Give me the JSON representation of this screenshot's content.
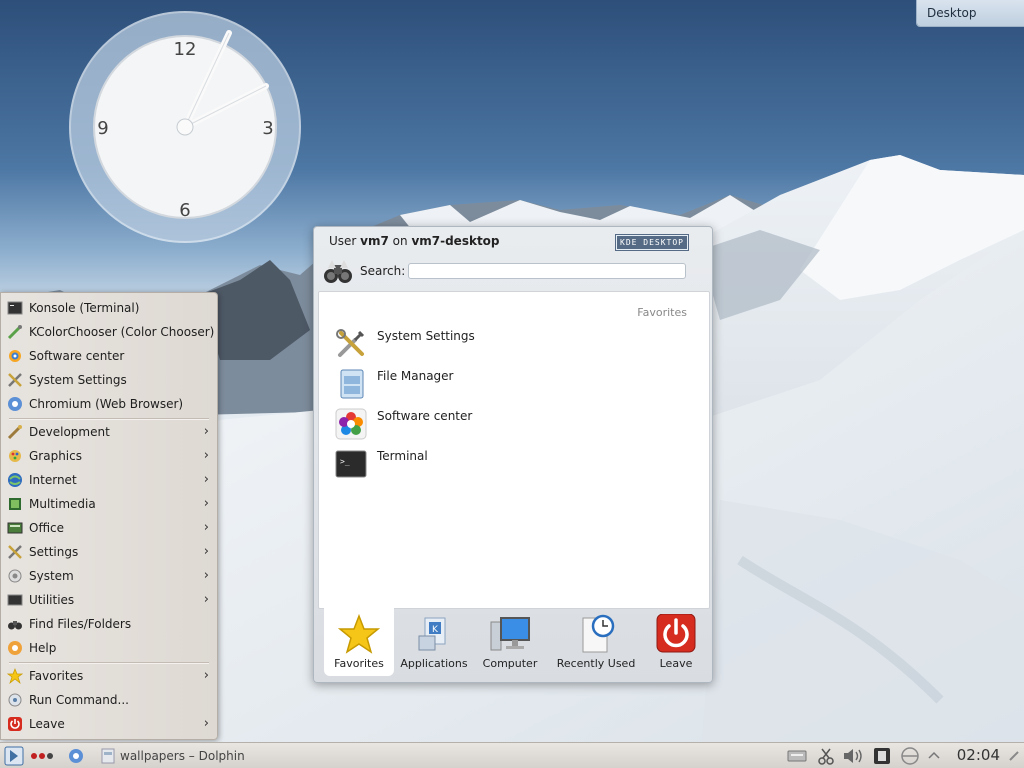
{
  "desktop_label": "Desktop",
  "clock": {
    "numerals": [
      "12",
      "3",
      "6",
      "9"
    ]
  },
  "kickoff": {
    "user_prefix": "User ",
    "user": "vm7",
    "on": " on ",
    "host": "vm7-desktop",
    "badge": "KDE DESKTOP",
    "search_label": "Search:",
    "search_value": "",
    "favorites_heading": "Favorites",
    "favorites": [
      {
        "label": "System Settings",
        "icon": "system-settings-icon"
      },
      {
        "label": "File Manager",
        "icon": "file-manager-icon"
      },
      {
        "label": "Software center",
        "icon": "software-center-icon"
      },
      {
        "label": "Terminal",
        "icon": "terminal-icon"
      }
    ],
    "tabs": [
      "Favorites",
      "Applications",
      "Computer",
      "Recently Used",
      "Leave"
    ]
  },
  "app_menu": [
    {
      "label": "Konsole (Terminal)",
      "icon": "konsole-icon",
      "submenu": false
    },
    {
      "label": "KColorChooser (Color Chooser)",
      "icon": "color-chooser-icon",
      "submenu": false
    },
    {
      "label": "Software center",
      "icon": "software-center-icon",
      "submenu": false
    },
    {
      "label": "System Settings",
      "icon": "system-settings-icon",
      "submenu": false
    },
    {
      "label": "Chromium (Web Browser)",
      "icon": "chromium-icon",
      "submenu": false
    },
    {
      "label": "Development",
      "icon": "development-icon",
      "submenu": true
    },
    {
      "label": "Graphics",
      "icon": "graphics-icon",
      "submenu": true
    },
    {
      "label": "Internet",
      "icon": "internet-icon",
      "submenu": true
    },
    {
      "label": "Multimedia",
      "icon": "multimedia-icon",
      "submenu": true
    },
    {
      "label": "Office",
      "icon": "office-icon",
      "submenu": true
    },
    {
      "label": "Settings",
      "icon": "settings-icon",
      "submenu": true
    },
    {
      "label": "System",
      "icon": "system-icon",
      "submenu": true
    },
    {
      "label": "Utilities",
      "icon": "utilities-icon",
      "submenu": true
    },
    {
      "label": "Find Files/Folders",
      "icon": "find-files-icon",
      "submenu": false
    },
    {
      "label": "Help",
      "icon": "help-icon",
      "submenu": false
    },
    {
      "label": "Favorites",
      "icon": "favorites-icon",
      "submenu": true
    },
    {
      "label": "Run Command...",
      "icon": "run-command-icon",
      "submenu": false
    },
    {
      "label": "Leave",
      "icon": "leave-icon",
      "submenu": true
    }
  ],
  "taskbar": {
    "task_label": "wallpapers – Dolphin",
    "time": "02:04"
  },
  "colors": {
    "sky_top": "#2d4f7a",
    "kde_badge": "#556b85",
    "leave_red": "#d62b1f"
  }
}
